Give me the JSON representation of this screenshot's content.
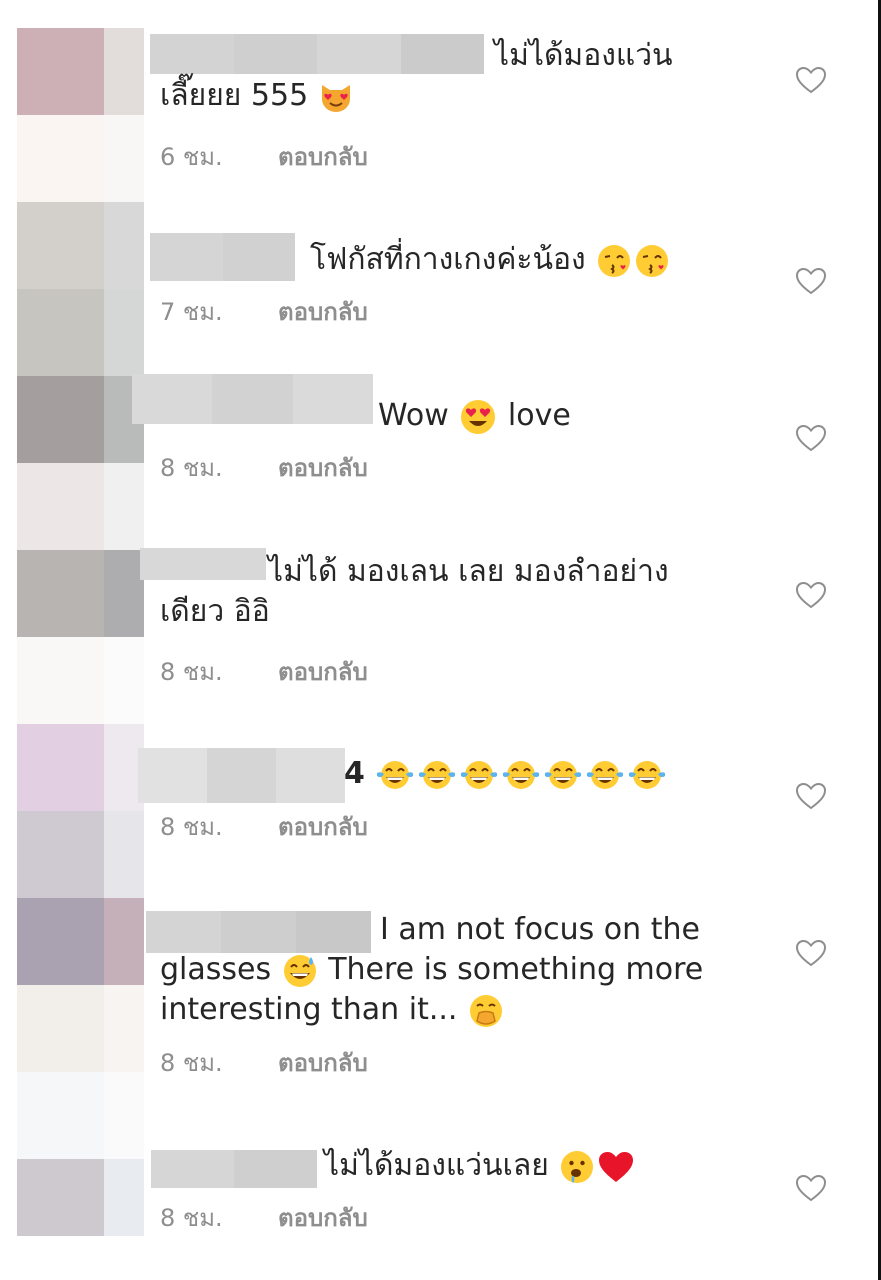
{
  "comments": [
    {
      "text": "ไม่ได้มองแว่น เลี๊ยยย 555",
      "emojis": [
        "heart-eyes-cat"
      ],
      "time": "6 ชม.",
      "reply_label": "ตอบกลับ"
    },
    {
      "text": "โฟกัสที่กางเกงค่ะน้อง",
      "emojis": [
        "kissing-heart",
        "kissing-heart"
      ],
      "time": "7 ชม.",
      "reply_label": "ตอบกลับ"
    },
    {
      "text": "Wow",
      "text_after": "love",
      "emojis": [
        "heart-eyes"
      ],
      "time": "8 ชม.",
      "reply_label": "ตอบกลับ"
    },
    {
      "text": "ไม่ได้ มองเลน เลย มองลำอย่าง เดียว อิอิ",
      "emojis": [],
      "time": "8 ชม.",
      "reply_label": "ตอบกลับ"
    },
    {
      "text": "4",
      "emojis": [
        "tears-of-joy",
        "tears-of-joy",
        "tears-of-joy",
        "tears-of-joy",
        "tears-of-joy",
        "tears-of-joy",
        "tears-of-joy"
      ],
      "time": "8 ชม.",
      "reply_label": "ตอบกลับ"
    },
    {
      "text": "I am not focus on the glasses",
      "text_after": "There is something more interesting than it...",
      "emojis": [
        "sweat-smile",
        "hand-over-mouth"
      ],
      "time": "8 ชม.",
      "reply_label": "ตอบกลับ"
    },
    {
      "text": "ไม่ได้มองแว่นเลย",
      "emojis": [
        "drooling-face",
        "red-heart"
      ],
      "time": "8 ชม.",
      "reply_label": "ตอบกลับ"
    }
  ],
  "icons": {
    "like": "heart-outline-icon"
  },
  "colors": {
    "text": "#262626",
    "meta": "#8e8e8e",
    "blur": "#d0d0d0"
  }
}
